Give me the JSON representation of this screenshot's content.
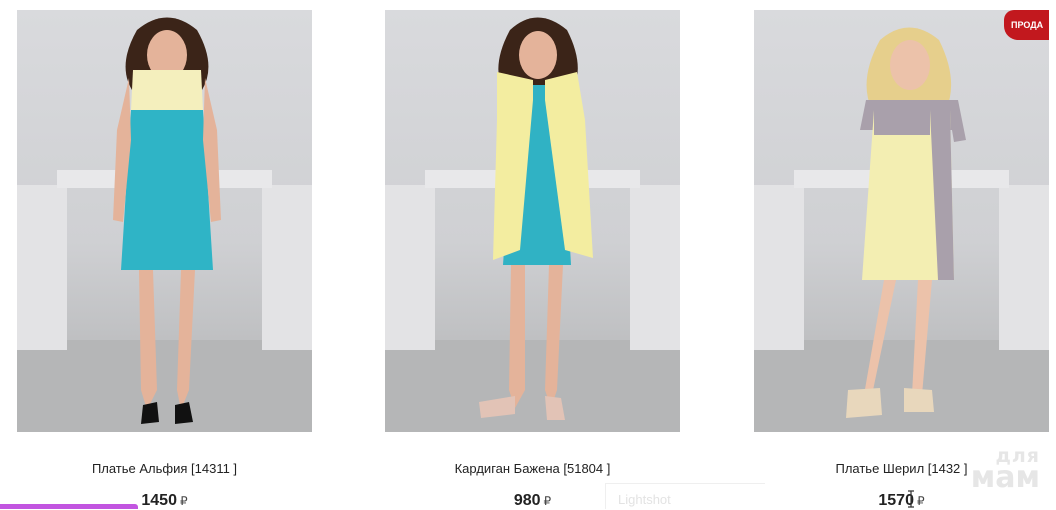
{
  "products": [
    {
      "name": "Платье Альфия [14311 ]",
      "price": "1450",
      "currency": "₽",
      "dress_colors": {
        "top": "#f4efbd",
        "body": "#2fb4c6"
      }
    },
    {
      "name": "Кардиган Бажена [51804 ]",
      "price": "980",
      "currency": "₽",
      "dress_colors": {
        "cardigan": "#f3eda0",
        "body": "#30b2c4"
      }
    },
    {
      "name": "Платье Шерил [1432 ]",
      "price": "1570",
      "currency": "₽",
      "badge": "ПРОДА",
      "dress_colors": {
        "front": "#f3eeb2",
        "side": "#a9a0ab"
      }
    }
  ],
  "overlay": {
    "watermark_line1": "для",
    "watermark_line2": "мам",
    "lightshot_label": "Lightshot"
  }
}
